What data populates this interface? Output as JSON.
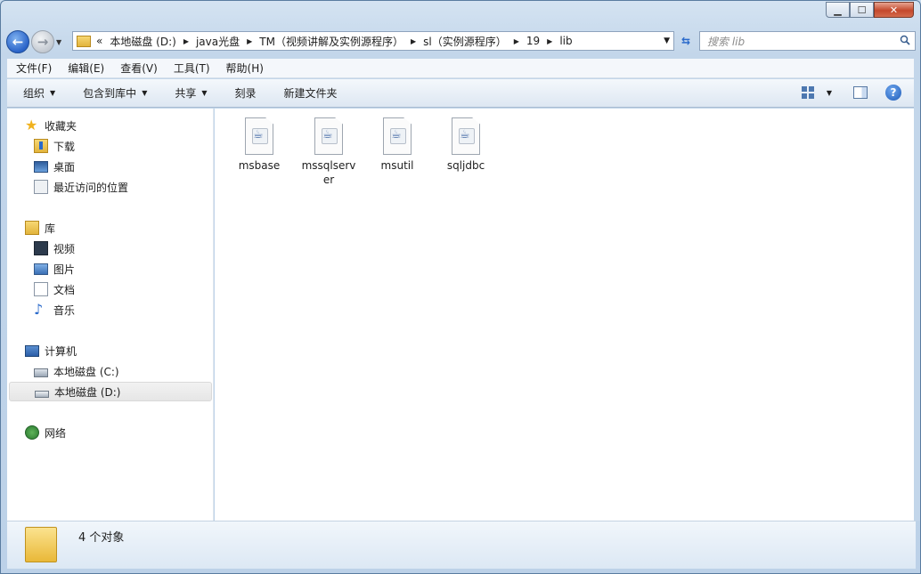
{
  "window": {
    "caption": {
      "minimize": "▁",
      "maximize": "☐",
      "close": "✕"
    }
  },
  "nav": {
    "back_label": "←",
    "forward_label": "→",
    "history_dropdown": "▼",
    "breadcrumbs": [
      "本地磁盘 (D:)",
      "java光盘",
      "TM（视频讲解及实例源程序）",
      "sl（实例源程序）",
      "19",
      "lib"
    ],
    "overflow": "«",
    "refresh_label": "⇆",
    "search_placeholder": "搜索 lib"
  },
  "menubar": [
    "文件(F)",
    "编辑(E)",
    "查看(V)",
    "工具(T)",
    "帮助(H)"
  ],
  "commandbar": {
    "organize": "组织",
    "include_in_library": "包含到库中",
    "share": "共享",
    "burn": "刻录",
    "new_folder": "新建文件夹",
    "help": "?"
  },
  "navpane": {
    "favorites": "收藏夹",
    "downloads": "下载",
    "desktop": "桌面",
    "recent": "最近访问的位置",
    "libraries": "库",
    "videos": "视频",
    "pictures": "图片",
    "documents": "文档",
    "music": "音乐",
    "computer": "计算机",
    "drive_c": "本地磁盘 (C:)",
    "drive_d": "本地磁盘 (D:)",
    "network": "网络"
  },
  "files": [
    "msbase",
    "mssqlserver",
    "msutil",
    "sqljdbc"
  ],
  "status": {
    "count_text": "4 个对象"
  },
  "icons": {
    "star": "★",
    "music_note": "♪",
    "dropdown": "▼"
  }
}
